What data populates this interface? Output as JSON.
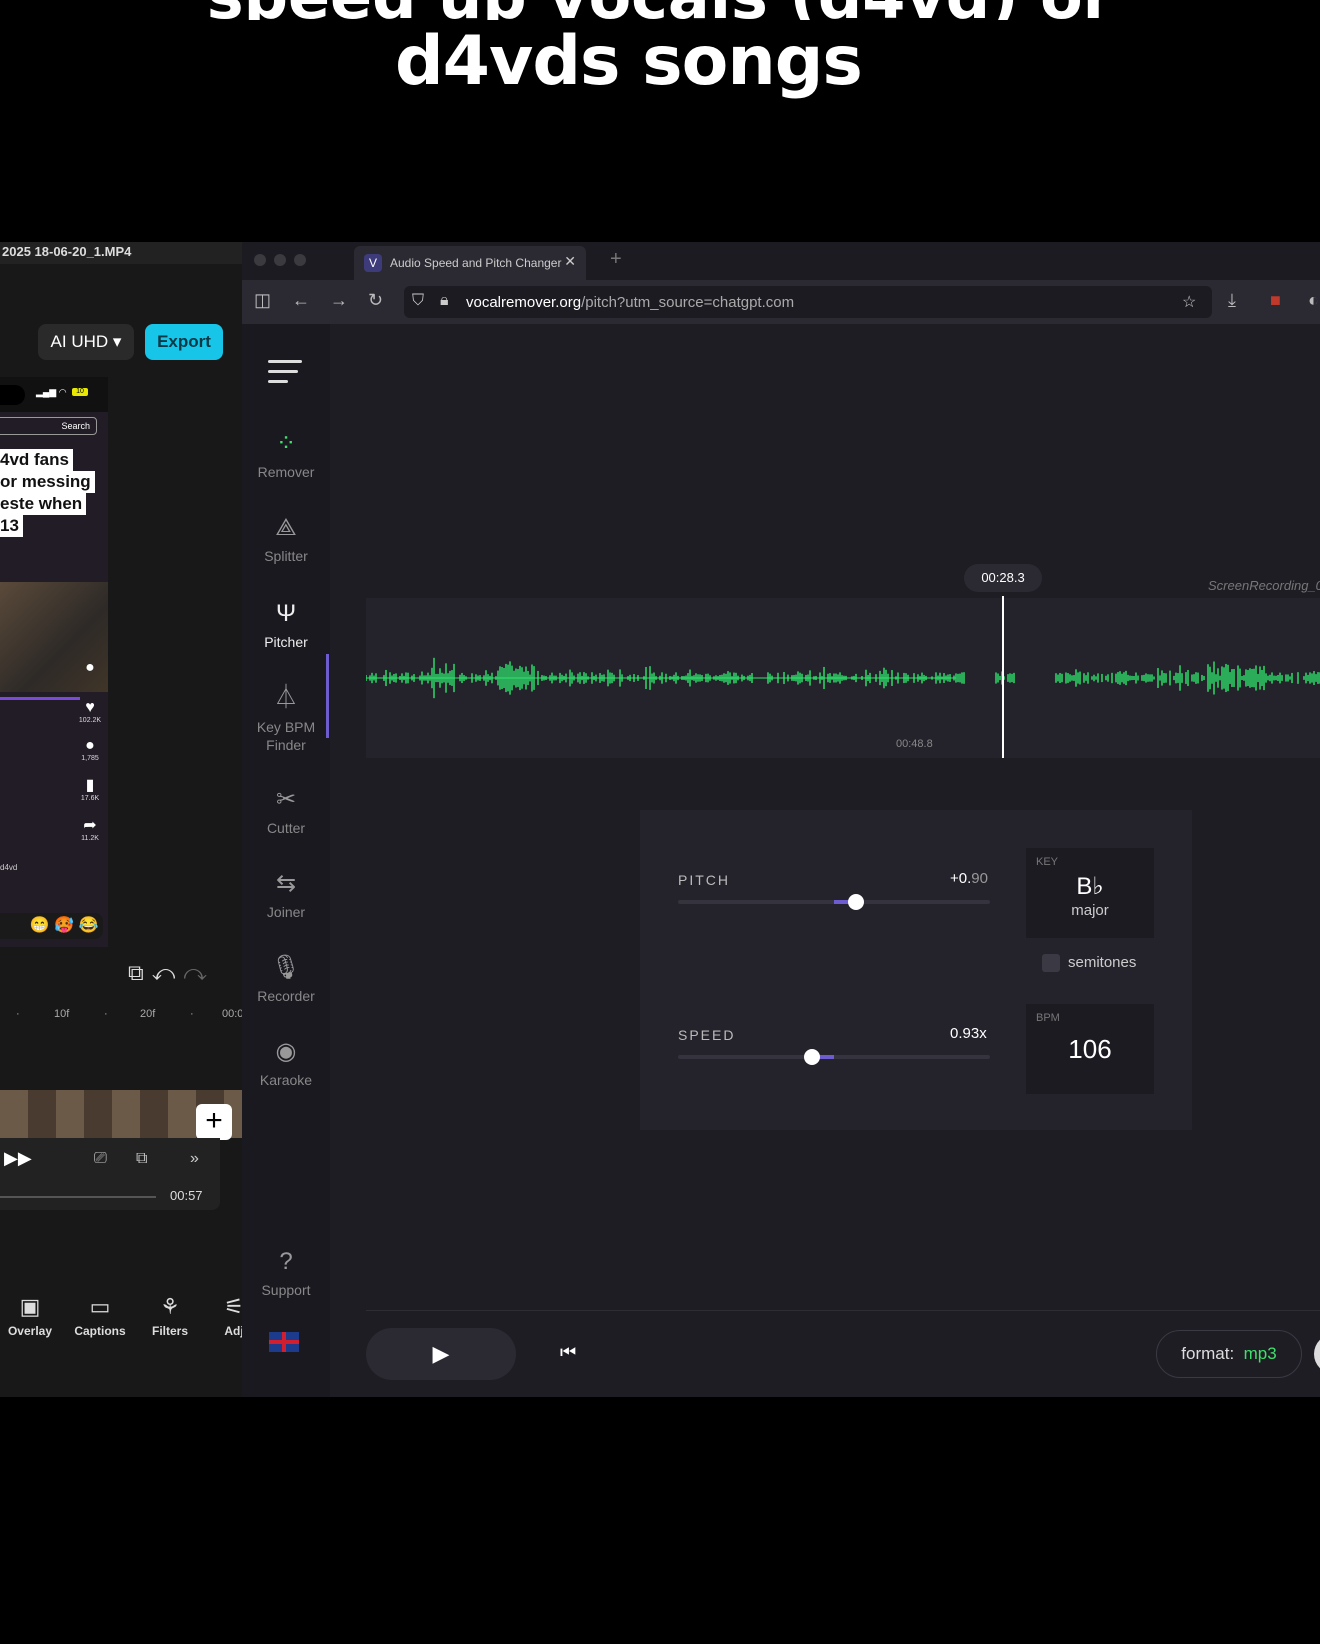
{
  "caption": {
    "line1_partial": "speed  up  vocals  (d4vd)  or",
    "line2": "d4vds songs"
  },
  "editor": {
    "file_title": "2025 18-06-20_1.MP4",
    "quality_label": "AI UHD",
    "export_label": "Export",
    "phone": {
      "search_label": "Search",
      "battery": "10",
      "overlay_lines": [
        "4vd fans",
        "or messing",
        "este when",
        "13"
      ],
      "likes": "102.2K",
      "comments": "1,785",
      "saves": "17.6K",
      "shares": "11.2K",
      "username": "d4vd"
    },
    "ruler": [
      "10f",
      "20f",
      "00:0"
    ],
    "duration": "00:57",
    "bottom_tools": [
      {
        "label": "Overlay",
        "icon": "overlay-icon"
      },
      {
        "label": "Captions",
        "icon": "captions-icon"
      },
      {
        "label": "Filters",
        "icon": "filters-icon"
      },
      {
        "label": "Adj",
        "icon": "adjust-icon"
      }
    ]
  },
  "browser": {
    "tab_title": "Audio Speed and Pitch Changer",
    "tab_favicon": "V",
    "url_domain": "vocalremover.org",
    "url_path": "/pitch?utm_source=chatgpt.com"
  },
  "sidebar": {
    "items": [
      {
        "label": "Remover",
        "icon": "remover-icon"
      },
      {
        "label": "Splitter",
        "icon": "splitter-icon"
      },
      {
        "label": "Pitcher",
        "icon": "tuning-fork-icon",
        "active": true
      },
      {
        "label": "Key BPM Finder",
        "icon": "metronome-icon"
      },
      {
        "label": "Cutter",
        "icon": "scissors-icon"
      },
      {
        "label": "Joiner",
        "icon": "joiner-icon"
      },
      {
        "label": "Recorder",
        "icon": "microphone-icon"
      },
      {
        "label": "Karaoke",
        "icon": "karaoke-icon"
      }
    ],
    "support_label": "Support"
  },
  "waveform": {
    "file_name": "ScreenRecording_0",
    "playhead_time": "00:28.3",
    "lower_time": "00:48.8",
    "color": "#2fe66d"
  },
  "controls": {
    "pitch_label": "PITCH",
    "pitch_value_main": "+0.",
    "pitch_value_dim": "90",
    "pitch_fraction": 0.57,
    "speed_label": "SPEED",
    "speed_value": "0.93x",
    "speed_fraction": 0.43,
    "key_label": "KEY",
    "key_value": "B♭",
    "key_mode": "major",
    "semitones_label": "semitones",
    "bpm_label": "BPM",
    "bpm_value": "106"
  },
  "player": {
    "format_label": "format:",
    "format_value": "mp3"
  }
}
